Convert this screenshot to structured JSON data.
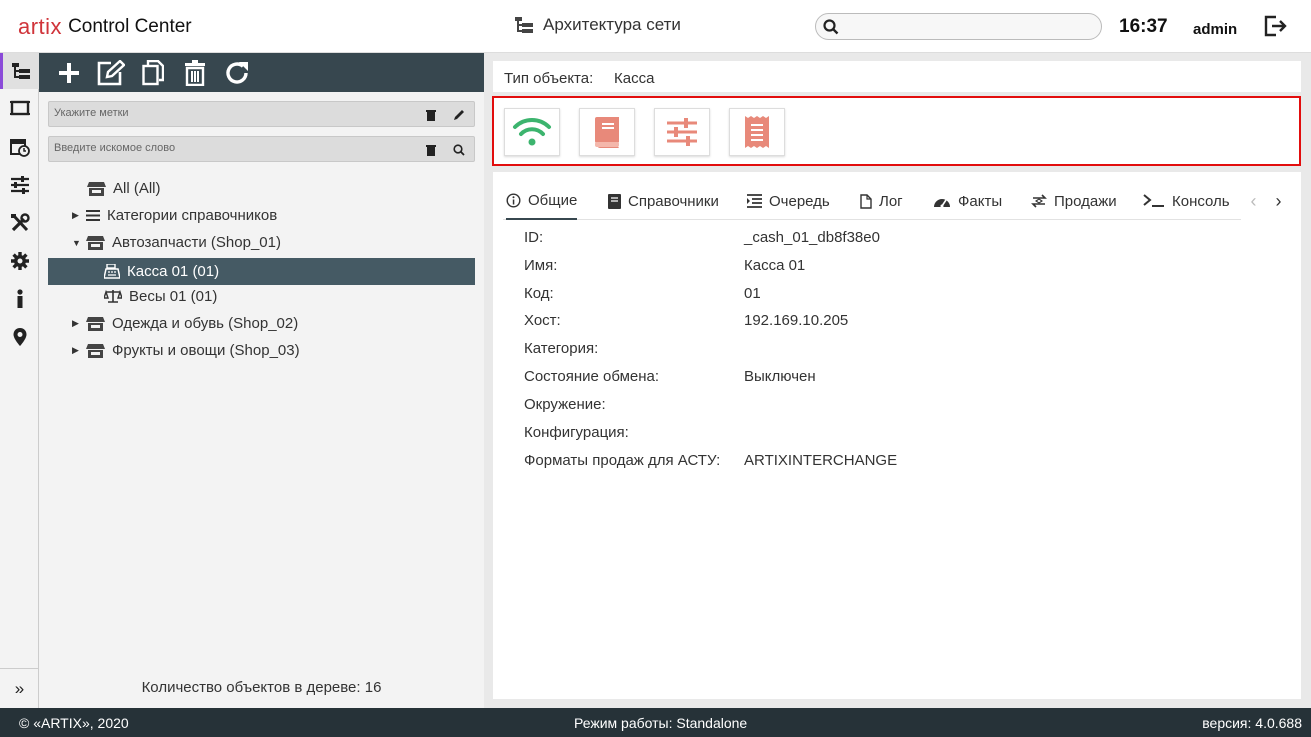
{
  "header": {
    "logo_text": "artix",
    "app_name": "Control Center",
    "title": "Архитектура сети",
    "search_placeholder": "",
    "time": "16:37",
    "user": "admin"
  },
  "rail": {
    "icons": [
      "network-tree-icon",
      "monitor-icon",
      "schedule-icon",
      "sliders-icon",
      "tools-icon",
      "gear-icon",
      "info-icon",
      "location-pin-icon"
    ],
    "expand": "»"
  },
  "tree_panel": {
    "toolbar": [
      "add-icon",
      "edit-icon",
      "copy-icon",
      "delete-icon",
      "refresh-icon"
    ],
    "tags_placeholder": "Укажите метки",
    "search_placeholder": "Введите искомое слово",
    "nodes": [
      {
        "label": "All (All)",
        "icon": "store-icon",
        "caret": ""
      },
      {
        "label": "Категории справочников",
        "icon": "list-icon",
        "caret": "▶"
      },
      {
        "label": "Автозапчасти (Shop_01)",
        "icon": "store-icon",
        "caret": "▼"
      },
      {
        "label": "Касса 01 (01)",
        "icon": "cash-register-icon",
        "caret": ""
      },
      {
        "label": "Весы 01 (01)",
        "icon": "scales-icon",
        "caret": ""
      },
      {
        "label": "Одежда и обувь (Shop_02)",
        "icon": "store-icon",
        "caret": "▶"
      },
      {
        "label": "Фрукты и овощи (Shop_03)",
        "icon": "store-icon",
        "caret": "▶"
      }
    ],
    "selected_index": 3,
    "count_text": "Количество объектов в дереве: 16"
  },
  "object": {
    "type_label": "Тип объекта:",
    "type_value": "Касса"
  },
  "actions": {
    "buttons": [
      "wifi-icon",
      "book-icon",
      "sliders-icon",
      "receipt-icon"
    ],
    "colors": {
      "wifi": "#3cb46e",
      "others": "#e8897a"
    }
  },
  "tabs": [
    {
      "label": "Общие",
      "icon": "info-icon"
    },
    {
      "label": "Справочники",
      "icon": "book-icon"
    },
    {
      "label": "Очередь",
      "icon": "queue-icon"
    },
    {
      "label": "Лог",
      "icon": "file-icon"
    },
    {
      "label": "Факты",
      "icon": "gauge-icon"
    },
    {
      "label": "Продажи",
      "icon": "exchange-icon"
    },
    {
      "label": "Консоль",
      "icon": "terminal-icon"
    }
  ],
  "details": [
    {
      "key": "ID:",
      "value": "_cash_01_db8f38e0"
    },
    {
      "key": "Имя:",
      "value": "Касса 01"
    },
    {
      "key": "Код:",
      "value": "01"
    },
    {
      "key": "Хост:",
      "value": "192.169.10.205"
    },
    {
      "key": "Категория:",
      "value": ""
    },
    {
      "key": "Состояние обмена:",
      "value": "Выключен"
    },
    {
      "key": "Окружение:",
      "value": ""
    },
    {
      "key": "Конфигурация:",
      "value": ""
    },
    {
      "key": "Форматы продаж для АСТУ:",
      "value": "ARTIXINTERCHANGE"
    }
  ],
  "footer": {
    "copyright": "© «ARTIX», 2020",
    "mode": "Режим работы: Standalone",
    "version": "версия: 4.0.688"
  },
  "colors": {
    "toolbar": "#37474f",
    "selected": "#455a64",
    "footer": "#263238",
    "highlight_border": "#e20d0d",
    "brand": "#d0343a"
  }
}
